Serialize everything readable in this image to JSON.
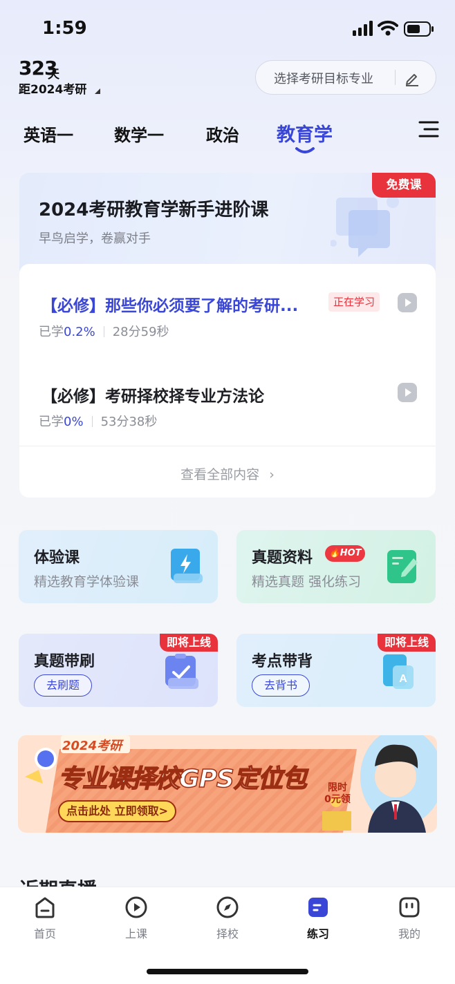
{
  "status_bar": {
    "time": "1:59"
  },
  "header": {
    "days_number": "323",
    "days_unit": "天",
    "days_subtitle": "距2024考研",
    "target_label": "选择考研目标专业",
    "edit_icon": "pencil-icon"
  },
  "tabs": [
    {
      "label": "英语一",
      "active": false
    },
    {
      "label": "数学一",
      "active": false
    },
    {
      "label": "政治",
      "active": false
    },
    {
      "label": "教育学",
      "active": true
    }
  ],
  "course": {
    "badge": "免费课",
    "title": "2024考研教育学新手进阶课",
    "subtitle": "早鸟启学，卷赢对手",
    "lessons": [
      {
        "title": "【必修】那些你必须要了解的考研...",
        "status": "正在学习",
        "learned_label": "已学",
        "progress": "0.2%",
        "duration": "28分59秒",
        "active": true
      },
      {
        "title": "【必修】考研择校择专业方法论",
        "status": "",
        "learned_label": "已学",
        "progress": "0%",
        "duration": "53分38秒",
        "active": false
      }
    ],
    "see_all": "查看全部内容"
  },
  "tiles": [
    {
      "title": "体验课",
      "subtitle": "精选教育学体验课",
      "icon": "lightning-book-icon"
    },
    {
      "title": "真题资料",
      "subtitle": "精选真题 强化练习",
      "hot_badge": "HOT",
      "icon": "notebook-pen-icon"
    },
    {
      "title": "真题带刷",
      "badge": "即将上线",
      "button": "去刷题",
      "icon": "checklist-icon"
    },
    {
      "title": "考点带背",
      "badge": "即将上线",
      "button": "去背书",
      "icon": "flashcard-icon"
    }
  ],
  "banner": {
    "tag": "2024考研",
    "headline": "专业课择校GPS定位包",
    "cta": "点击此处 立即领取>",
    "promo_line1": "限时",
    "promo_line2": "0元领"
  },
  "section_heading_partial": "近期直播",
  "bottom_nav": [
    {
      "label": "首页",
      "icon": "home-icon",
      "active": false
    },
    {
      "label": "上课",
      "icon": "play-circle-icon",
      "active": false
    },
    {
      "label": "择校",
      "icon": "compass-icon",
      "active": false
    },
    {
      "label": "练习",
      "icon": "practice-icon",
      "active": true
    },
    {
      "label": "我的",
      "icon": "profile-face-icon",
      "active": false
    }
  ],
  "colors": {
    "accent": "#3a47d6",
    "badge_red": "#e8333c",
    "text_primary": "#1e1f24",
    "text_secondary": "#8a8d96"
  }
}
